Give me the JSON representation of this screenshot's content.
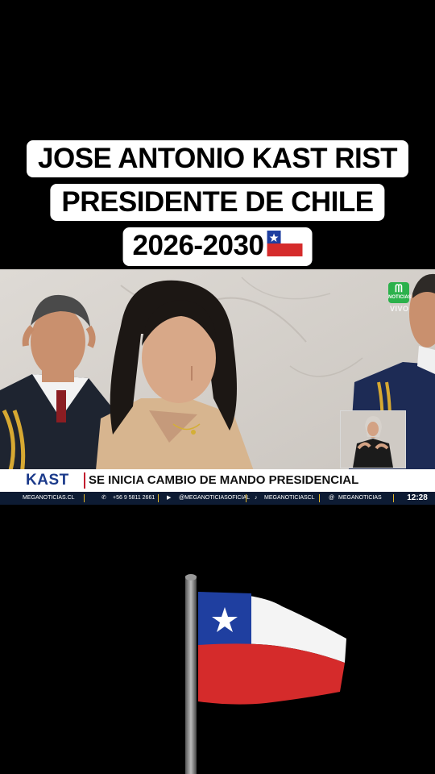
{
  "caption": {
    "line1": "JOSE ANTONIO KAST RIST",
    "line2": "PRESIDENTE DE CHILE",
    "line3": "2026-2030"
  },
  "broadcast": {
    "logo_text": "NOTICIAS",
    "live_label": "VIVO",
    "kast_brand": "KAST",
    "headline": "SE INICIA CAMBIO DE MANDO PRESIDENCIAL",
    "ticker": {
      "site": "MEGANOTICIAS.CL",
      "whatsapp": "+56 9 5811 2661",
      "youtube": "@MEGANOTICIASOFICIAL",
      "tiktok": "MEGANOTICIASCL",
      "threads": "MEGANOTICIAS",
      "time": "12:28"
    }
  },
  "colors": {
    "chile_blue": "#1f3fa0",
    "chile_red": "#d52b2b",
    "mega_green": "#2bb14b",
    "kast_blue": "#1b3a8a"
  }
}
